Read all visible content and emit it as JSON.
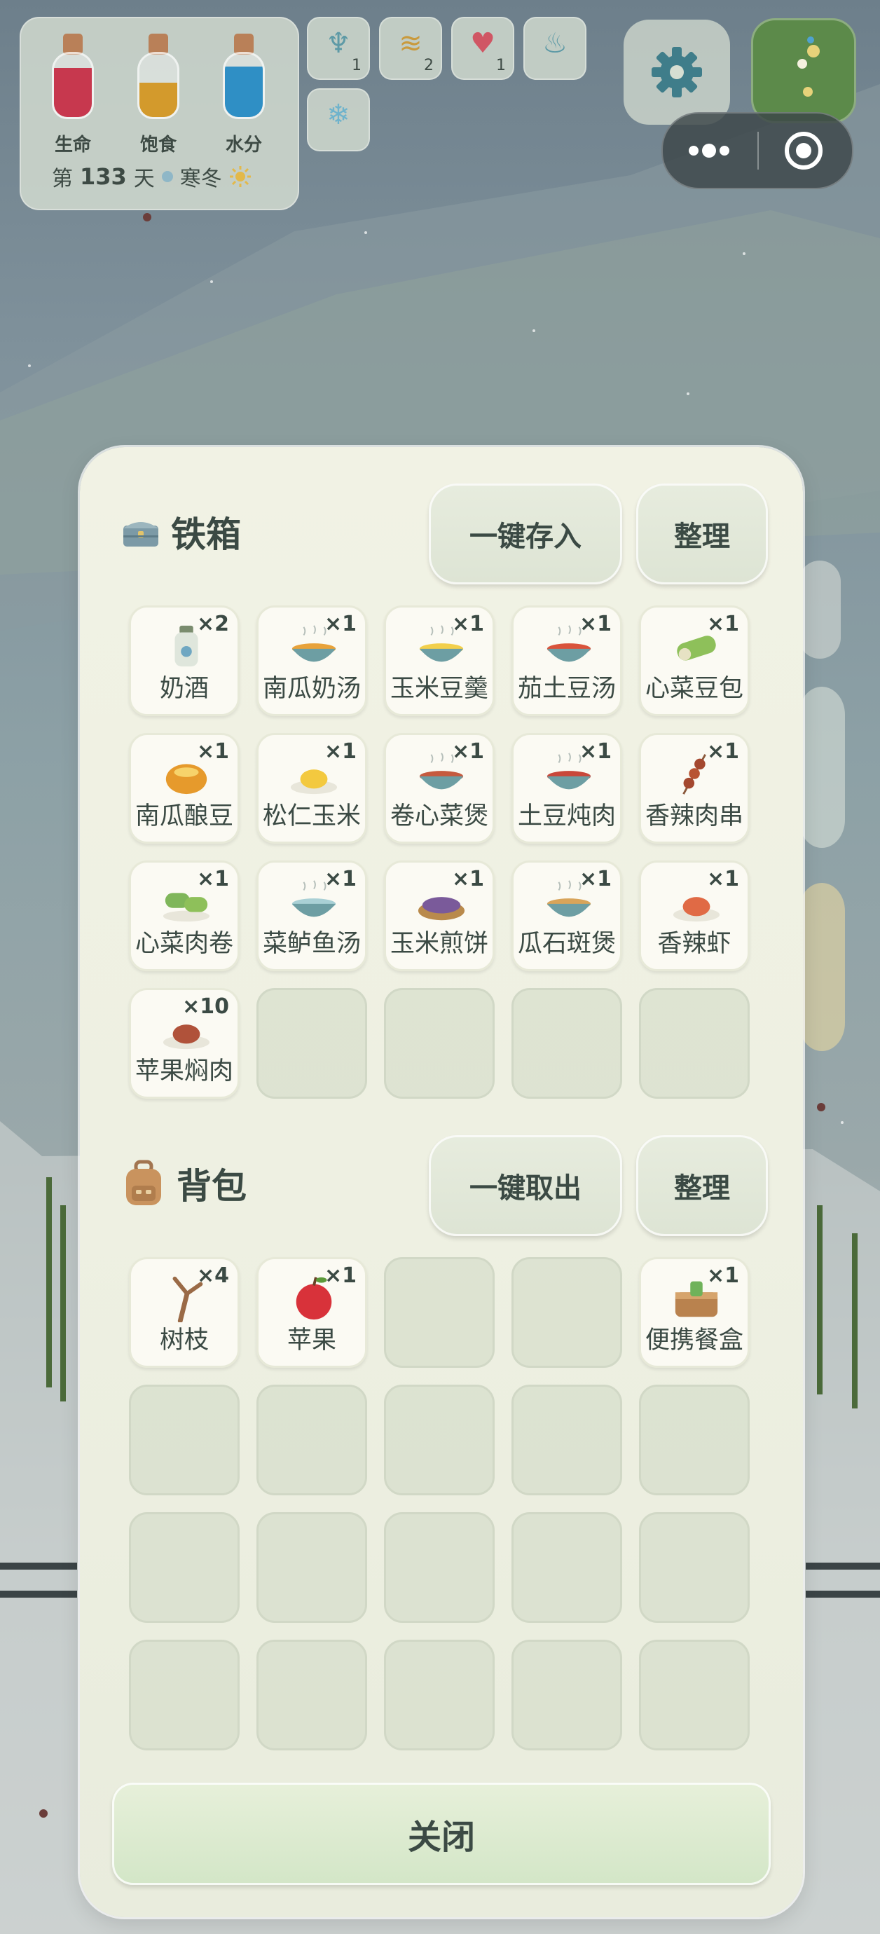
{
  "hud": {
    "stats": [
      {
        "label": "生命",
        "color": "#c7384e",
        "level": 0.78
      },
      {
        "label": "饱食",
        "color": "#d39a2c",
        "level": 0.55
      },
      {
        "label": "水分",
        "color": "#2f8fc5",
        "level": 0.8
      }
    ],
    "day_prefix": "第",
    "day_number": "133",
    "day_suffix": "天",
    "season": "寒冬",
    "buffs": [
      {
        "icon": "sprout-icon",
        "glyph": "♆",
        "count": "1"
      },
      {
        "icon": "beehive-icon",
        "glyph": "≋",
        "count": "2"
      },
      {
        "icon": "heart-plus-icon",
        "glyph": "♥",
        "count": "1"
      },
      {
        "icon": "water-bowl-icon",
        "glyph": "♨",
        "count": ""
      },
      {
        "icon": "snowflake-icon",
        "glyph": "❄",
        "count": ""
      }
    ]
  },
  "chest": {
    "title": "铁箱",
    "store_all_label": "一键存入",
    "sort_label": "整理",
    "slots": [
      {
        "name": "奶酒",
        "qty": "×2",
        "icon": "milk-wine-bottle-icon"
      },
      {
        "name": "南瓜奶汤",
        "qty": "×1",
        "icon": "pumpkin-milk-soup-icon"
      },
      {
        "name": "玉米豆羹",
        "qty": "×1",
        "icon": "corn-bean-soup-icon"
      },
      {
        "name": "茄土豆汤",
        "qty": "×1",
        "icon": "tomato-potato-soup-icon"
      },
      {
        "name": "心菜豆包",
        "qty": "×1",
        "icon": "cabbage-bean-wrap-icon"
      },
      {
        "name": "南瓜酿豆",
        "qty": "×1",
        "icon": "stuffed-pumpkin-icon"
      },
      {
        "name": "松仁玉米",
        "qty": "×1",
        "icon": "pine-nut-corn-icon"
      },
      {
        "name": "卷心菜煲",
        "qty": "×1",
        "icon": "cabbage-stew-icon"
      },
      {
        "name": "土豆炖肉",
        "qty": "×1",
        "icon": "potato-meat-stew-icon"
      },
      {
        "name": "香辣肉串",
        "qty": "×1",
        "icon": "spicy-skewer-icon"
      },
      {
        "name": "心菜肉卷",
        "qty": "×1",
        "icon": "cabbage-meat-roll-icon"
      },
      {
        "name": "菜鲈鱼汤",
        "qty": "×1",
        "icon": "perch-soup-icon"
      },
      {
        "name": "玉米煎饼",
        "qty": "×1",
        "icon": "corn-pancake-icon"
      },
      {
        "name": "瓜石斑煲",
        "qty": "×1",
        "icon": "grouper-stew-icon"
      },
      {
        "name": "香辣虾",
        "qty": "×1",
        "icon": "spicy-shrimp-icon"
      },
      {
        "name": "苹果焖肉",
        "qty": "×10",
        "icon": "apple-braised-meat-icon"
      },
      null,
      null,
      null,
      null
    ]
  },
  "backpack": {
    "title": "背包",
    "take_all_label": "一键取出",
    "sort_label": "整理",
    "slots": [
      {
        "name": "树枝",
        "qty": "×4",
        "icon": "branch-icon"
      },
      {
        "name": "苹果",
        "qty": "×1",
        "icon": "apple-icon"
      },
      null,
      null,
      {
        "name": "便携餐盒",
        "qty": "×1",
        "icon": "lunch-box-icon"
      },
      null,
      null,
      null,
      null,
      null,
      null,
      null,
      null,
      null,
      null,
      null,
      null,
      null,
      null,
      null
    ]
  },
  "close_label": "关闭"
}
